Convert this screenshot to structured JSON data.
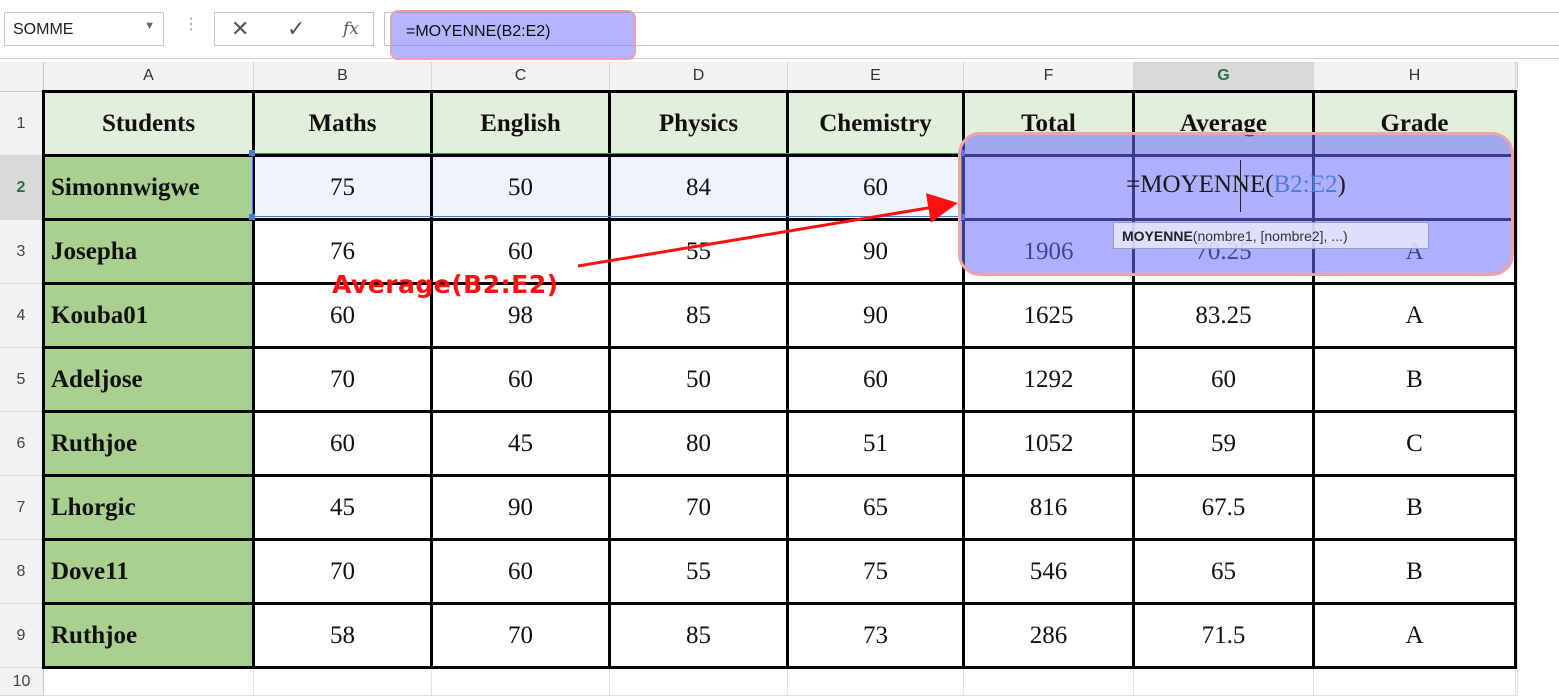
{
  "formula_bar": {
    "name_box": "SOMME",
    "cancel_glyph": "✕",
    "enter_glyph": "✓",
    "fx_label": "fx",
    "formula": "=MOYENNE(B2:E2)"
  },
  "columns": [
    "A",
    "B",
    "C",
    "D",
    "E",
    "F",
    "G",
    "H"
  ],
  "selected_column": "G",
  "rows": [
    "1",
    "2",
    "3",
    "4",
    "5",
    "6",
    "7",
    "8",
    "9",
    "10"
  ],
  "selected_row": "2",
  "table": {
    "headers": [
      "Students",
      "Maths",
      "English",
      "Physics",
      "Chemistry",
      "Total",
      "Average",
      "Grade"
    ],
    "rows": [
      [
        "Simonnwigwe",
        "75",
        "50",
        "84",
        "60",
        "",
        "",
        ""
      ],
      [
        "Josepha",
        "76",
        "60",
        "55",
        "90",
        "1906",
        "70.25",
        "A"
      ],
      [
        "Kouba01",
        "60",
        "98",
        "85",
        "90",
        "1625",
        "83.25",
        "A"
      ],
      [
        "Adeljose",
        "70",
        "60",
        "50",
        "60",
        "1292",
        "60",
        "B"
      ],
      [
        "Ruthjoe",
        "60",
        "45",
        "80",
        "51",
        "1052",
        "59",
        "C"
      ],
      [
        "Lhorgic",
        "45",
        "90",
        "70",
        "65",
        "816",
        "67.5",
        "B"
      ],
      [
        "Dove11",
        "70",
        "60",
        "55",
        "75",
        "546",
        "65",
        "B"
      ],
      [
        "Ruthjoe",
        "58",
        "70",
        "85",
        "73",
        "286",
        "71.5",
        "A"
      ]
    ]
  },
  "in_cell_editor": {
    "func": "=MOYENNE(",
    "range": "B2:E2",
    "close": ")"
  },
  "tooltip": {
    "func": "MOYENNE",
    "args": "(nombre1, [nombre2], ...)"
  },
  "annotation": "Average(B2:E2)",
  "colors": {
    "header_fill": "#e2efda",
    "name_fill": "#a9d08e",
    "highlight": "#6e6eff",
    "annotation": "#ff1010"
  }
}
